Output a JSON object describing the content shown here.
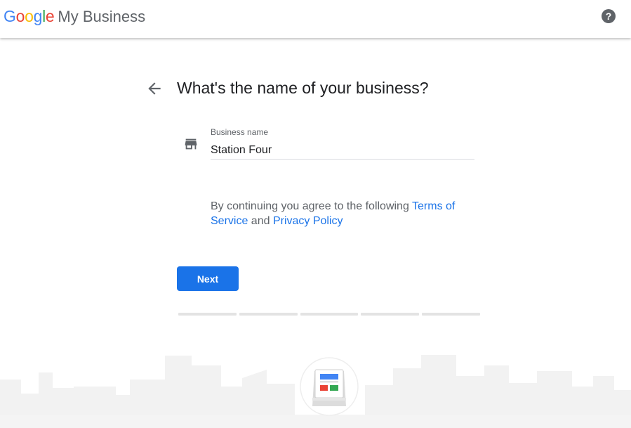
{
  "header": {
    "logo_letters": [
      {
        "char": "G",
        "color": "#4285F4"
      },
      {
        "char": "o",
        "color": "#EA4335"
      },
      {
        "char": "o",
        "color": "#FBBC05"
      },
      {
        "char": "g",
        "color": "#4285F4"
      },
      {
        "char": "l",
        "color": "#34A853"
      },
      {
        "char": "e",
        "color": "#EA4335"
      }
    ],
    "product_name": "My Business",
    "help_icon": "help-circle-icon",
    "help_glyph": "?"
  },
  "main": {
    "back_icon": "arrow-back-icon",
    "title": "What's the name of your business?",
    "field": {
      "icon": "storefront-icon",
      "label": "Business name",
      "value": "Station Four"
    },
    "terms": {
      "prefix": "By continuing you agree to the following ",
      "terms_link": "Terms of Service",
      "conjunction": " and ",
      "privacy_link": "Privacy Policy"
    },
    "next_label": "Next",
    "progress": {
      "total_steps": 5,
      "completed_steps": 0
    }
  },
  "colors": {
    "primary": "#1a73e8",
    "text": "#202124",
    "secondary_text": "#5f6368",
    "progress_track": "#e3e3e3",
    "skyline": "#f1f1f1"
  }
}
